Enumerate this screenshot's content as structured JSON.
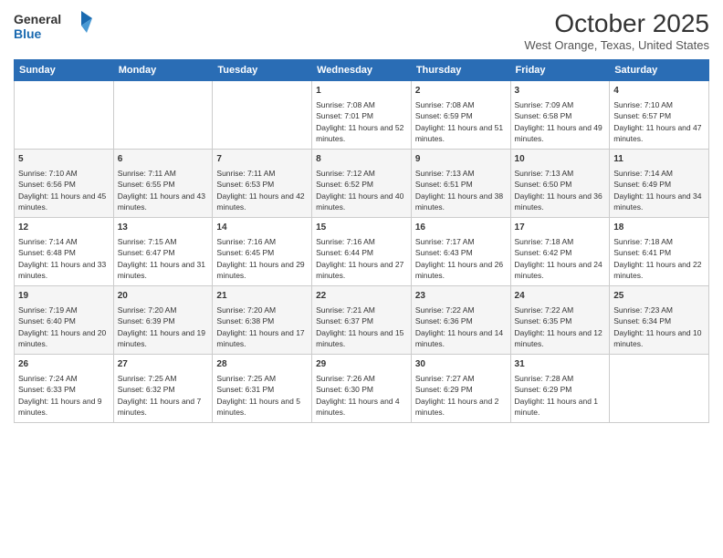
{
  "logo": {
    "line1": "General",
    "line2": "Blue",
    "icon_color": "#1a6ab0"
  },
  "header": {
    "title": "October 2025",
    "subtitle": "West Orange, Texas, United States"
  },
  "days_of_week": [
    "Sunday",
    "Monday",
    "Tuesday",
    "Wednesday",
    "Thursday",
    "Friday",
    "Saturday"
  ],
  "weeks": [
    [
      {
        "day": "",
        "info": ""
      },
      {
        "day": "",
        "info": ""
      },
      {
        "day": "",
        "info": ""
      },
      {
        "day": "1",
        "info": "Sunrise: 7:08 AM\nSunset: 7:01 PM\nDaylight: 11 hours and 52 minutes."
      },
      {
        "day": "2",
        "info": "Sunrise: 7:08 AM\nSunset: 6:59 PM\nDaylight: 11 hours and 51 minutes."
      },
      {
        "day": "3",
        "info": "Sunrise: 7:09 AM\nSunset: 6:58 PM\nDaylight: 11 hours and 49 minutes."
      },
      {
        "day": "4",
        "info": "Sunrise: 7:10 AM\nSunset: 6:57 PM\nDaylight: 11 hours and 47 minutes."
      }
    ],
    [
      {
        "day": "5",
        "info": "Sunrise: 7:10 AM\nSunset: 6:56 PM\nDaylight: 11 hours and 45 minutes."
      },
      {
        "day": "6",
        "info": "Sunrise: 7:11 AM\nSunset: 6:55 PM\nDaylight: 11 hours and 43 minutes."
      },
      {
        "day": "7",
        "info": "Sunrise: 7:11 AM\nSunset: 6:53 PM\nDaylight: 11 hours and 42 minutes."
      },
      {
        "day": "8",
        "info": "Sunrise: 7:12 AM\nSunset: 6:52 PM\nDaylight: 11 hours and 40 minutes."
      },
      {
        "day": "9",
        "info": "Sunrise: 7:13 AM\nSunset: 6:51 PM\nDaylight: 11 hours and 38 minutes."
      },
      {
        "day": "10",
        "info": "Sunrise: 7:13 AM\nSunset: 6:50 PM\nDaylight: 11 hours and 36 minutes."
      },
      {
        "day": "11",
        "info": "Sunrise: 7:14 AM\nSunset: 6:49 PM\nDaylight: 11 hours and 34 minutes."
      }
    ],
    [
      {
        "day": "12",
        "info": "Sunrise: 7:14 AM\nSunset: 6:48 PM\nDaylight: 11 hours and 33 minutes."
      },
      {
        "day": "13",
        "info": "Sunrise: 7:15 AM\nSunset: 6:47 PM\nDaylight: 11 hours and 31 minutes."
      },
      {
        "day": "14",
        "info": "Sunrise: 7:16 AM\nSunset: 6:45 PM\nDaylight: 11 hours and 29 minutes."
      },
      {
        "day": "15",
        "info": "Sunrise: 7:16 AM\nSunset: 6:44 PM\nDaylight: 11 hours and 27 minutes."
      },
      {
        "day": "16",
        "info": "Sunrise: 7:17 AM\nSunset: 6:43 PM\nDaylight: 11 hours and 26 minutes."
      },
      {
        "day": "17",
        "info": "Sunrise: 7:18 AM\nSunset: 6:42 PM\nDaylight: 11 hours and 24 minutes."
      },
      {
        "day": "18",
        "info": "Sunrise: 7:18 AM\nSunset: 6:41 PM\nDaylight: 11 hours and 22 minutes."
      }
    ],
    [
      {
        "day": "19",
        "info": "Sunrise: 7:19 AM\nSunset: 6:40 PM\nDaylight: 11 hours and 20 minutes."
      },
      {
        "day": "20",
        "info": "Sunrise: 7:20 AM\nSunset: 6:39 PM\nDaylight: 11 hours and 19 minutes."
      },
      {
        "day": "21",
        "info": "Sunrise: 7:20 AM\nSunset: 6:38 PM\nDaylight: 11 hours and 17 minutes."
      },
      {
        "day": "22",
        "info": "Sunrise: 7:21 AM\nSunset: 6:37 PM\nDaylight: 11 hours and 15 minutes."
      },
      {
        "day": "23",
        "info": "Sunrise: 7:22 AM\nSunset: 6:36 PM\nDaylight: 11 hours and 14 minutes."
      },
      {
        "day": "24",
        "info": "Sunrise: 7:22 AM\nSunset: 6:35 PM\nDaylight: 11 hours and 12 minutes."
      },
      {
        "day": "25",
        "info": "Sunrise: 7:23 AM\nSunset: 6:34 PM\nDaylight: 11 hours and 10 minutes."
      }
    ],
    [
      {
        "day": "26",
        "info": "Sunrise: 7:24 AM\nSunset: 6:33 PM\nDaylight: 11 hours and 9 minutes."
      },
      {
        "day": "27",
        "info": "Sunrise: 7:25 AM\nSunset: 6:32 PM\nDaylight: 11 hours and 7 minutes."
      },
      {
        "day": "28",
        "info": "Sunrise: 7:25 AM\nSunset: 6:31 PM\nDaylight: 11 hours and 5 minutes."
      },
      {
        "day": "29",
        "info": "Sunrise: 7:26 AM\nSunset: 6:30 PM\nDaylight: 11 hours and 4 minutes."
      },
      {
        "day": "30",
        "info": "Sunrise: 7:27 AM\nSunset: 6:29 PM\nDaylight: 11 hours and 2 minutes."
      },
      {
        "day": "31",
        "info": "Sunrise: 7:28 AM\nSunset: 6:29 PM\nDaylight: 11 hours and 1 minute."
      },
      {
        "day": "",
        "info": ""
      }
    ]
  ]
}
